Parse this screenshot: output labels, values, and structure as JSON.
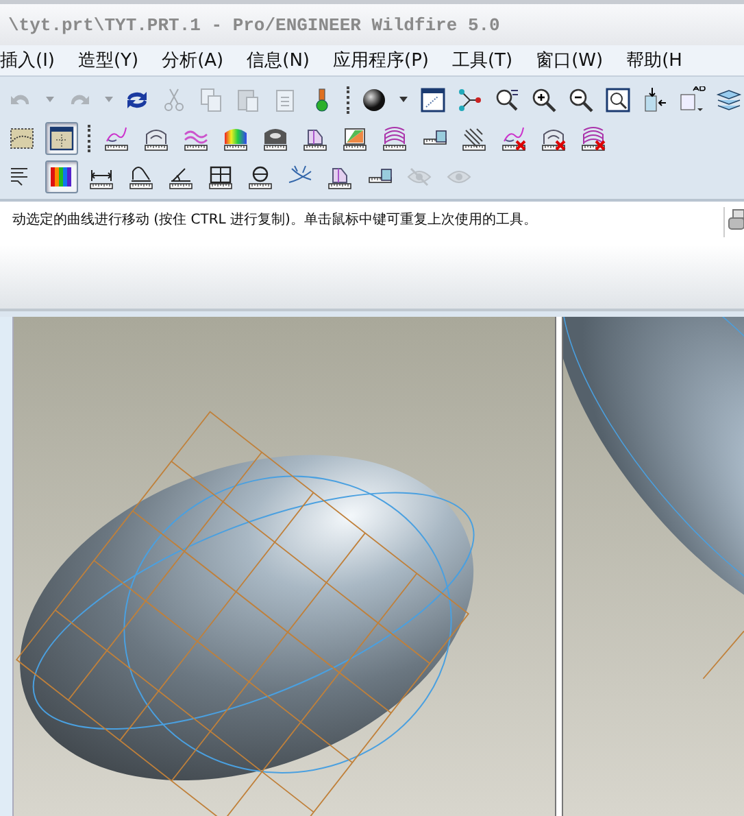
{
  "window": {
    "title": "\\tyt.prt\\TYT.PRT.1 - Pro/ENGINEER Wildfire 5.0"
  },
  "menu": [
    "插入(I)",
    "造型(Y)",
    "分析(A)",
    "信息(N)",
    "应用程序(P)",
    "工具(T)",
    "窗口(W)",
    "帮助(H"
  ],
  "toolbars": [
    [
      [
        {
          "kind": "undo",
          "pressed": false,
          "disabled": true
        },
        {
          "kind": "caret",
          "pressed": false,
          "disabled": true
        },
        {
          "kind": "redo",
          "pressed": false,
          "disabled": true
        },
        {
          "kind": "caret",
          "pressed": false,
          "disabled": true
        },
        {
          "kind": "regen",
          "pressed": false,
          "disabled": false
        },
        {
          "kind": "cut",
          "pressed": false,
          "disabled": true
        },
        {
          "kind": "copy",
          "pressed": false,
          "disabled": true
        },
        {
          "kind": "paste",
          "pressed": false,
          "disabled": true
        },
        {
          "kind": "paste-list",
          "pressed": false,
          "disabled": true
        },
        {
          "kind": "light",
          "pressed": false,
          "disabled": false
        }
      ],
      [
        {
          "kind": "sphere",
          "pressed": false,
          "disabled": false
        },
        {
          "kind": "caret",
          "pressed": false,
          "disabled": false
        },
        {
          "kind": "view",
          "pressed": false,
          "disabled": false
        },
        {
          "kind": "node",
          "pressed": false,
          "disabled": false
        },
        {
          "kind": "spin",
          "pressed": false,
          "disabled": false
        },
        {
          "kind": "zoom-in",
          "pressed": false,
          "disabled": false
        },
        {
          "kind": "zoom-out",
          "pressed": false,
          "disabled": false
        },
        {
          "kind": "refit",
          "pressed": false,
          "disabled": false
        },
        {
          "kind": "import",
          "pressed": false,
          "disabled": false
        },
        {
          "kind": "label",
          "pressed": false,
          "disabled": false
        },
        {
          "kind": "layers",
          "pressed": false,
          "disabled": false
        }
      ]
    ],
    [
      [
        {
          "kind": "map",
          "pressed": false,
          "disabled": false
        },
        {
          "kind": "frame",
          "pressed": true,
          "disabled": false
        }
      ],
      [
        {
          "kind": "r-curve",
          "pressed": false,
          "disabled": false
        },
        {
          "kind": "r-contour",
          "pressed": false,
          "disabled": false
        },
        {
          "kind": "r-wave",
          "pressed": false,
          "disabled": false
        },
        {
          "kind": "r-rainbow",
          "pressed": false,
          "disabled": false
        },
        {
          "kind": "r-dark",
          "pressed": false,
          "disabled": false
        },
        {
          "kind": "r-prism",
          "pressed": false,
          "disabled": false
        },
        {
          "kind": "r-fan",
          "pressed": false,
          "disabled": false
        },
        {
          "kind": "r-arcs",
          "pressed": false,
          "disabled": false
        },
        {
          "kind": "r-save",
          "pressed": false,
          "disabled": false
        },
        {
          "kind": "r-hatch",
          "pressed": false,
          "disabled": false
        },
        {
          "kind": "r-curve-x",
          "pressed": false,
          "disabled": false
        },
        {
          "kind": "r-contour-x",
          "pressed": false,
          "disabled": false
        },
        {
          "kind": "r-arcs-x",
          "pressed": false,
          "disabled": false
        }
      ]
    ],
    [
      [
        {
          "kind": "lines",
          "pressed": false,
          "disabled": false
        },
        {
          "kind": "spectrum",
          "pressed": true,
          "disabled": false
        },
        {
          "kind": "r-dim",
          "pressed": false,
          "disabled": false
        },
        {
          "kind": "r-profile",
          "pressed": false,
          "disabled": false
        },
        {
          "kind": "r-angle",
          "pressed": false,
          "disabled": false
        },
        {
          "kind": "r-grid",
          "pressed": false,
          "disabled": false
        },
        {
          "kind": "r-circle",
          "pressed": false,
          "disabled": false
        },
        {
          "kind": "r-cross",
          "pressed": false,
          "disabled": false
        },
        {
          "kind": "r-prism",
          "pressed": false,
          "disabled": false
        },
        {
          "kind": "r-save",
          "pressed": false,
          "disabled": false
        },
        {
          "kind": "eye-slash",
          "pressed": false,
          "disabled": true
        },
        {
          "kind": "eye",
          "pressed": false,
          "disabled": true
        }
      ]
    ]
  ],
  "message": "动选定的曲线进行移动 (按住 CTRL 进行复制)。单击鼠标中键可重复上次使用的工具。"
}
